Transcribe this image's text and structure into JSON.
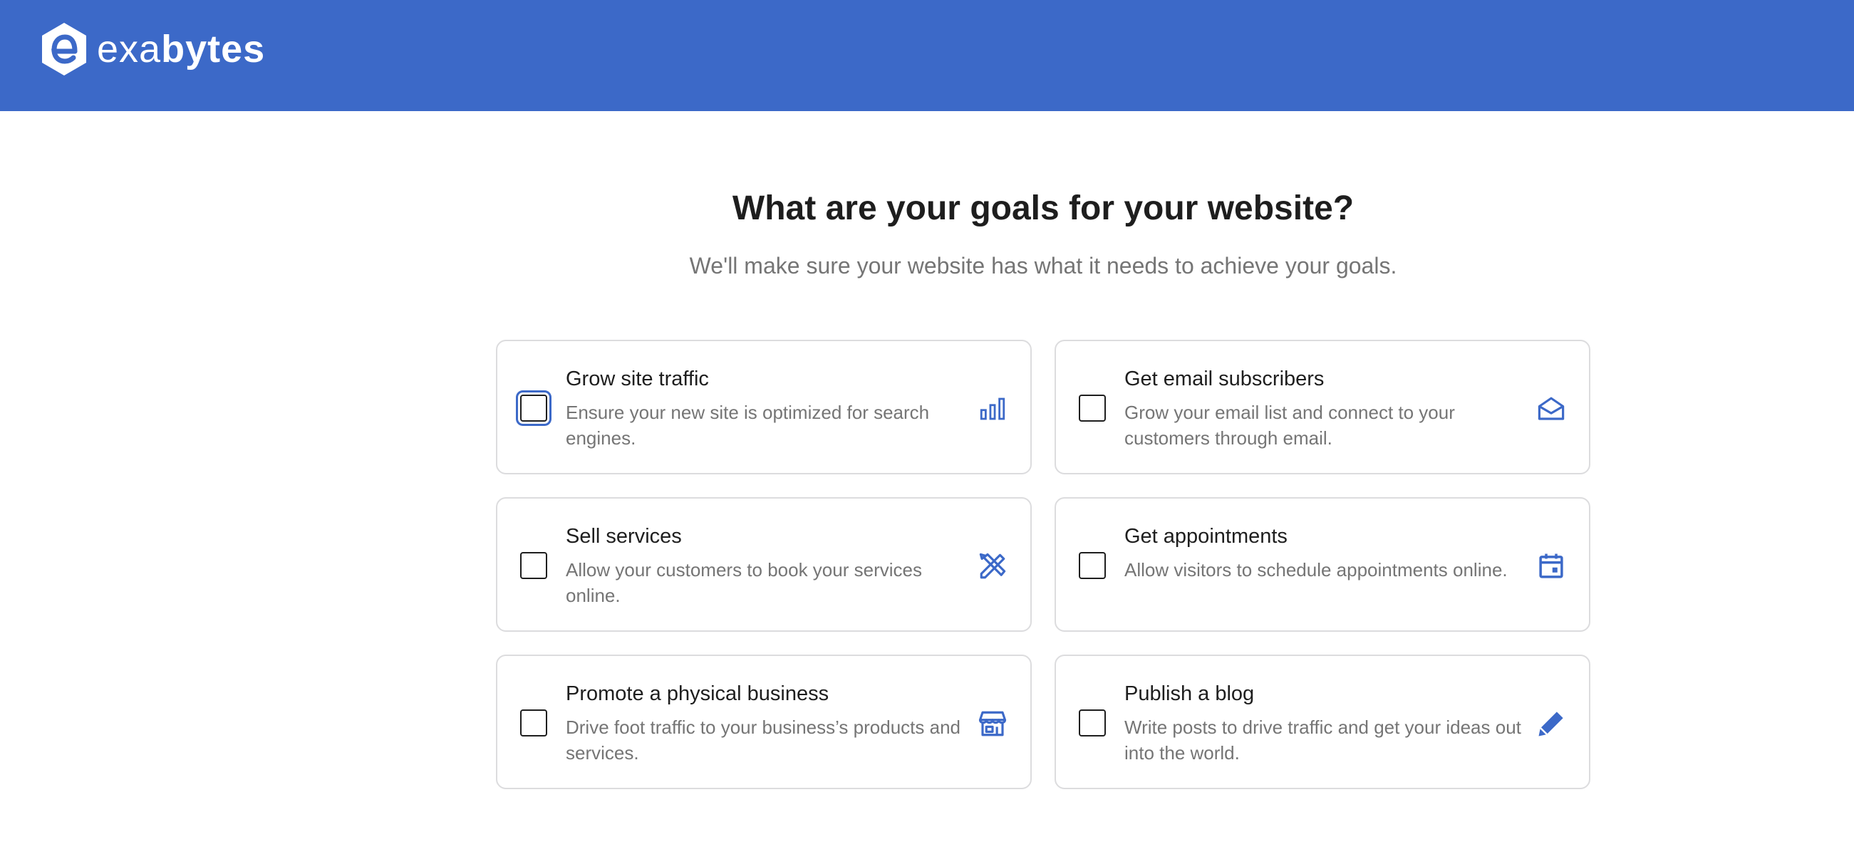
{
  "header": {
    "brand_light": "exa",
    "brand_bold": "bytes",
    "brand_color": "#3c69c8"
  },
  "page": {
    "title": "What are your goals for your website?",
    "subtitle": "We'll make sure your website has what it needs to achieve your goals."
  },
  "goals": [
    {
      "title": "Grow site traffic",
      "description": "Ensure your new site is optimized for search engines.",
      "icon": "bar-chart-icon",
      "checked": false
    },
    {
      "title": "Get email subscribers",
      "description": "Grow your email list and connect to your customers through email.",
      "icon": "envelope-icon",
      "checked": false
    },
    {
      "title": "Sell services",
      "description": "Allow your customers to book your services online.",
      "icon": "tools-icon",
      "checked": false
    },
    {
      "title": "Get appointments",
      "description": "Allow visitors to schedule appointments online.",
      "icon": "calendar-icon",
      "checked": false
    },
    {
      "title": "Promote a physical business",
      "description": "Drive foot traffic to your business’s products and services.",
      "icon": "store-icon",
      "checked": false
    },
    {
      "title": "Publish a blog",
      "description": "Write posts to drive traffic and get your ideas out into the world.",
      "icon": "pencil-icon",
      "checked": false
    }
  ]
}
